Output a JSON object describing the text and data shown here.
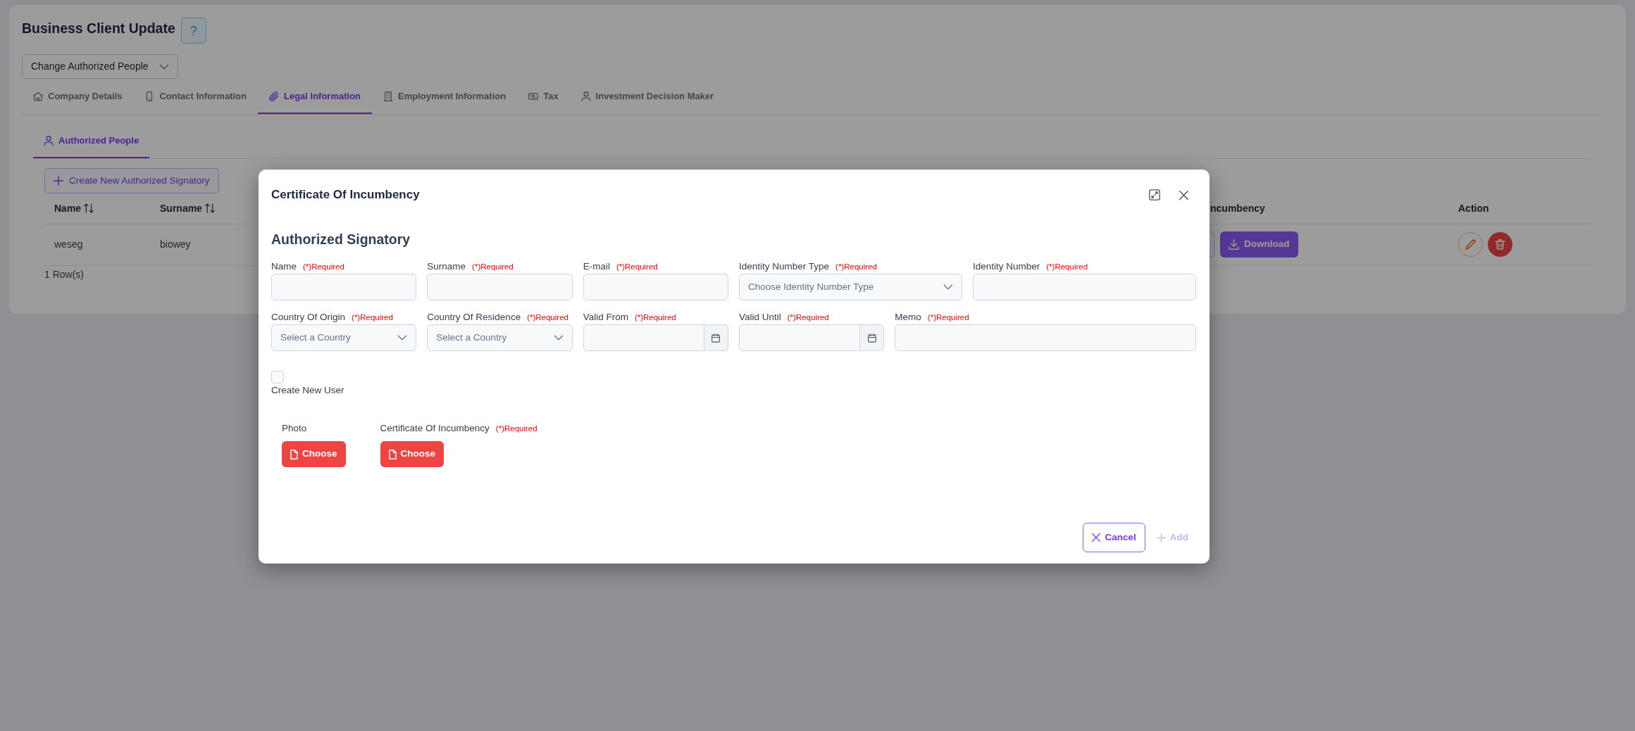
{
  "page": {
    "title": "Business Client Update",
    "help_button": "?",
    "mode_select": "Change Authorized People"
  },
  "tabs": [
    {
      "label": "Company Details",
      "selected": false
    },
    {
      "label": "Contact Information",
      "selected": false
    },
    {
      "label": "Legal Information",
      "selected": true
    },
    {
      "label": "Employment Information",
      "selected": false
    },
    {
      "label": "Tax",
      "selected": false
    },
    {
      "label": "Investment Decision Maker",
      "selected": false
    }
  ],
  "subtabs": [
    {
      "label": "Authorized People",
      "selected": true
    }
  ],
  "create_button": "Create New Authorized Signatory",
  "table": {
    "columns": [
      {
        "label": "Name",
        "sortable": true
      },
      {
        "label": "Surname",
        "sortable": true
      },
      {
        "label": "ncumbency"
      },
      {
        "label": "Action"
      }
    ],
    "rows": [
      {
        "cells": [
          "weseg",
          "biowey"
        ],
        "download_button": "Download"
      }
    ],
    "row_count": "1 Row(s)"
  },
  "modal": {
    "title": "Certificate Of Incumbency",
    "heading": "Authorized Signatory",
    "field_rows": [
      [
        {
          "label": "Name",
          "required_note": "(*)Required",
          "kind": "text"
        },
        {
          "label": "Surname",
          "required_note": "(*)Required",
          "kind": "text"
        },
        {
          "label": "E-mail",
          "required_note": "(*)Required",
          "kind": "text"
        },
        {
          "label": "Identity Number Type",
          "required_note": "(*)Required",
          "kind": "select",
          "placeholder": "Choose Identity Number Type"
        },
        {
          "label": "Identity Number",
          "required_note": "(*)Required",
          "kind": "text"
        }
      ],
      [
        {
          "label": "Country Of Origin",
          "required_note": "(*)Required",
          "kind": "select",
          "placeholder": "Select a Country"
        },
        {
          "label": "Country Of Residence",
          "required_note": "(*)Required",
          "kind": "select",
          "placeholder": "Select a Country"
        },
        {
          "label": "Valid From",
          "required_note": "(*)Required",
          "kind": "date"
        },
        {
          "label": "Valid Until",
          "required_note": "(*)Required",
          "kind": "date"
        },
        {
          "label": "Memo",
          "required_note": "(*)Required",
          "kind": "text"
        }
      ]
    ],
    "create_user": {
      "label": "Create New User",
      "checked": false
    },
    "uploads": [
      {
        "label": "Photo",
        "button": "Choose"
      },
      {
        "label": "Certificate Of Incumbency",
        "required_note": "(*)Required",
        "button": "Choose"
      }
    ],
    "buttons": [
      {
        "label": "Cancel",
        "kind": "cancel",
        "disabled": false
      },
      {
        "label": "Add",
        "kind": "add",
        "disabled": true
      }
    ]
  }
}
